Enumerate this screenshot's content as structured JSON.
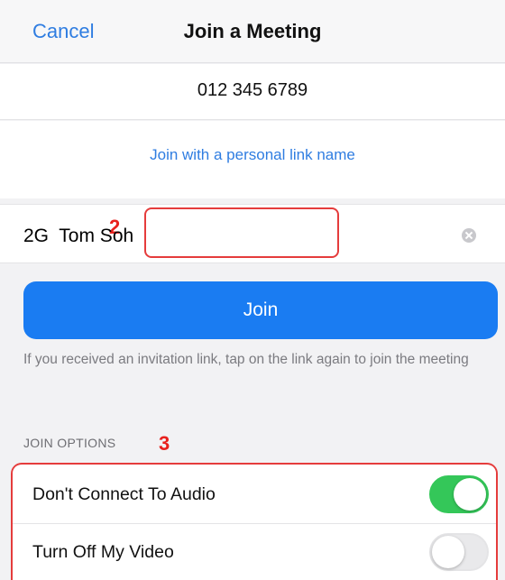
{
  "header": {
    "cancel_label": "Cancel",
    "title": "Join a Meeting"
  },
  "meeting": {
    "id": "012 345 6789",
    "personal_link_label": "Join with a personal link name"
  },
  "name_field": {
    "value": "2G  Tom Soh",
    "annotation": "2"
  },
  "join_button": {
    "label": "Join"
  },
  "hint": "If you received an invitation link, tap on the link again to join the meeting",
  "options": {
    "header": "JOIN OPTIONS",
    "annotation": "3",
    "items": [
      {
        "label": "Don't Connect To Audio",
        "on": true
      },
      {
        "label": "Turn Off My Video",
        "on": false
      }
    ]
  },
  "colors": {
    "accent": "#2f7de1",
    "join_button": "#1a7cf2",
    "toggle_on": "#34c759",
    "annotation": "#e53c3c"
  }
}
